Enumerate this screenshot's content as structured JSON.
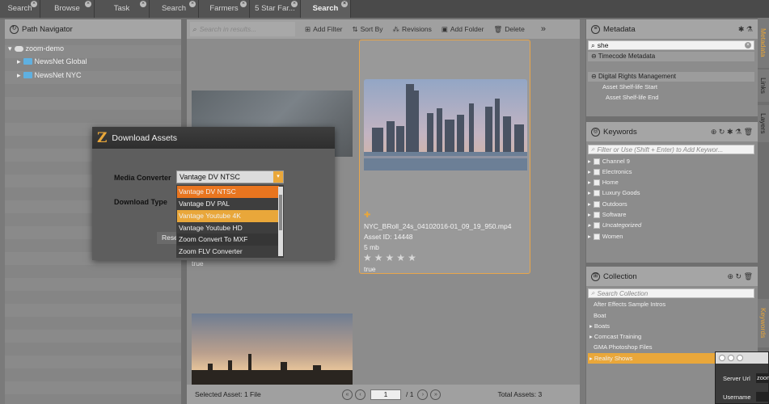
{
  "tabs": [
    {
      "label": "Search"
    },
    {
      "label": "Browse"
    },
    {
      "label": "Task"
    },
    {
      "label": "Search"
    },
    {
      "label": "Farmers"
    },
    {
      "label": "5 Star Far..."
    },
    {
      "label": "Search"
    }
  ],
  "path_navigator": {
    "title": "Path Navigator",
    "root": "zoom-demo",
    "children": [
      "NewsNet Global",
      "NewsNet NYC"
    ]
  },
  "toolbar": {
    "search_placeholder": "Search in results...",
    "add_filter": "Add Filter",
    "sort_by": "Sort By",
    "revisions": "Revisions",
    "add_folder": "Add Folder",
    "delete": "Delete",
    "more": "»"
  },
  "assets": [
    {
      "name": "NYC_BRoll_24s_04102016-01_09_19_950.mp4",
      "id_label": "Asset ID: 14448",
      "size": "5 mb",
      "flag": "true",
      "rating": 0
    },
    {
      "flag": "true"
    }
  ],
  "footer": {
    "selected": "Selected Asset: 1 File",
    "page": "1",
    "page_of": "/ 1",
    "total": "Total Assets: 3"
  },
  "dialog": {
    "title": "Download Assets",
    "media_converter_label": "Media Converter",
    "media_converter_value": "Vantage DV NTSC",
    "download_type_label": "Download Type",
    "reset_partial": "Rese",
    "options": [
      "Vantage DV NTSC",
      "Vantage DV PAL",
      "Vantage Youtube 4K",
      "Vantage Youtube HD",
      "Zoom Convert To MXF",
      "Zoom FLV Converter"
    ]
  },
  "metadata": {
    "title": "Metadata",
    "search_value": "she",
    "section_timecode": "Timecode Metadata",
    "section_drm": "Digital Rights Management",
    "field_start": "Asset Shelf-life Start",
    "field_end": "Asset Shelf-life End"
  },
  "side_tabs": [
    "Metadata",
    "Links",
    "Layers",
    "Keywords"
  ],
  "keywords": {
    "title": "Keywords",
    "placeholder": "Filter or Use (Shift + Enter) to Add Keywor...",
    "items": [
      "Channel 9",
      "Electronics",
      "Home",
      "Luxury Goods",
      "Outdoors",
      "Software",
      "Uncategorized",
      "Women"
    ]
  },
  "collection": {
    "title": "Collection",
    "placeholder": "Search Collection",
    "items": [
      "After Effects Sample Intros",
      "Boat",
      "Boats",
      "Comcast Training",
      "GMA Photoshop Files",
      "Reality Shows"
    ]
  },
  "server_window": {
    "server_url_label": "Server Url",
    "server_url_value": "zoom",
    "username_label": "Username"
  },
  "colors": {
    "accent": "#e9751f",
    "highlight": "#e9a73a",
    "selection_border": "#e8a54a"
  }
}
